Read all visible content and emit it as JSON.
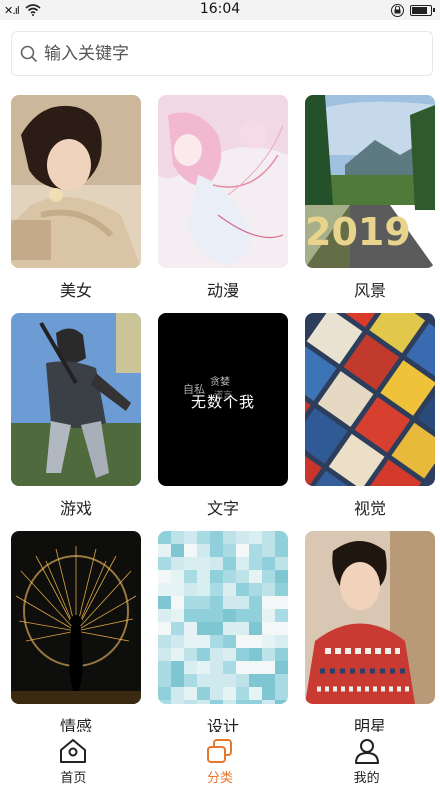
{
  "status": {
    "signal_text": "✕.ıl",
    "time": "16:04"
  },
  "search": {
    "placeholder": "输入关键字"
  },
  "categories": [
    {
      "label": "美女"
    },
    {
      "label": "动漫"
    },
    {
      "label": "风景"
    },
    {
      "label": "游戏"
    },
    {
      "label": "文字",
      "thumb_text": "无数个我",
      "thumb_small": [
        "自私",
        "贪婪",
        "谎言"
      ]
    },
    {
      "label": "视觉"
    },
    {
      "label": "情感"
    },
    {
      "label": "设计"
    },
    {
      "label": "明星"
    }
  ],
  "landscape_thumb_text": "2019",
  "tabs": [
    {
      "label": "首页",
      "icon": "home-icon"
    },
    {
      "label": "分类",
      "icon": "category-icon",
      "active": true
    },
    {
      "label": "我的",
      "icon": "user-icon"
    }
  ],
  "colors": {
    "accent": "#e8772e",
    "text": "#222222"
  }
}
